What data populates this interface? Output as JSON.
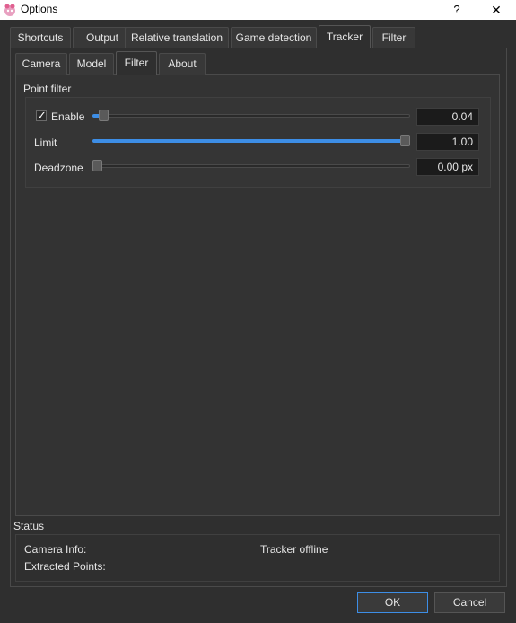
{
  "window": {
    "title": "Options",
    "help_glyph": "?",
    "close_glyph": "✕"
  },
  "top_tabs": [
    "Shortcuts",
    "Output",
    "Relative translation",
    "Game detection",
    "Tracker",
    "Filter"
  ],
  "top_tab_active": "Tracker",
  "sub_tabs": [
    "Camera",
    "Model",
    "Filter",
    "About"
  ],
  "sub_tab_active": "Filter",
  "point_filter": {
    "title": "Point filter",
    "enable": {
      "label": "Enable",
      "checked": true,
      "check_glyph": "✓"
    },
    "enable_value": "0.04",
    "enable_fraction": 0.02,
    "limit": {
      "label": "Limit",
      "value": "1.00",
      "fraction": 1.0
    },
    "deadzone": {
      "label": "Deadzone",
      "value": "0.00 px",
      "fraction": 0.0
    }
  },
  "status": {
    "title": "Status",
    "camera_info_label": "Camera Info:",
    "camera_info_value": "Tracker offline",
    "extracted_points_label": "Extracted Points:"
  },
  "buttons": {
    "ok": "OK",
    "cancel": "Cancel"
  },
  "colors": {
    "accent": "#3d8ee6",
    "background": "#2f2f2f"
  }
}
